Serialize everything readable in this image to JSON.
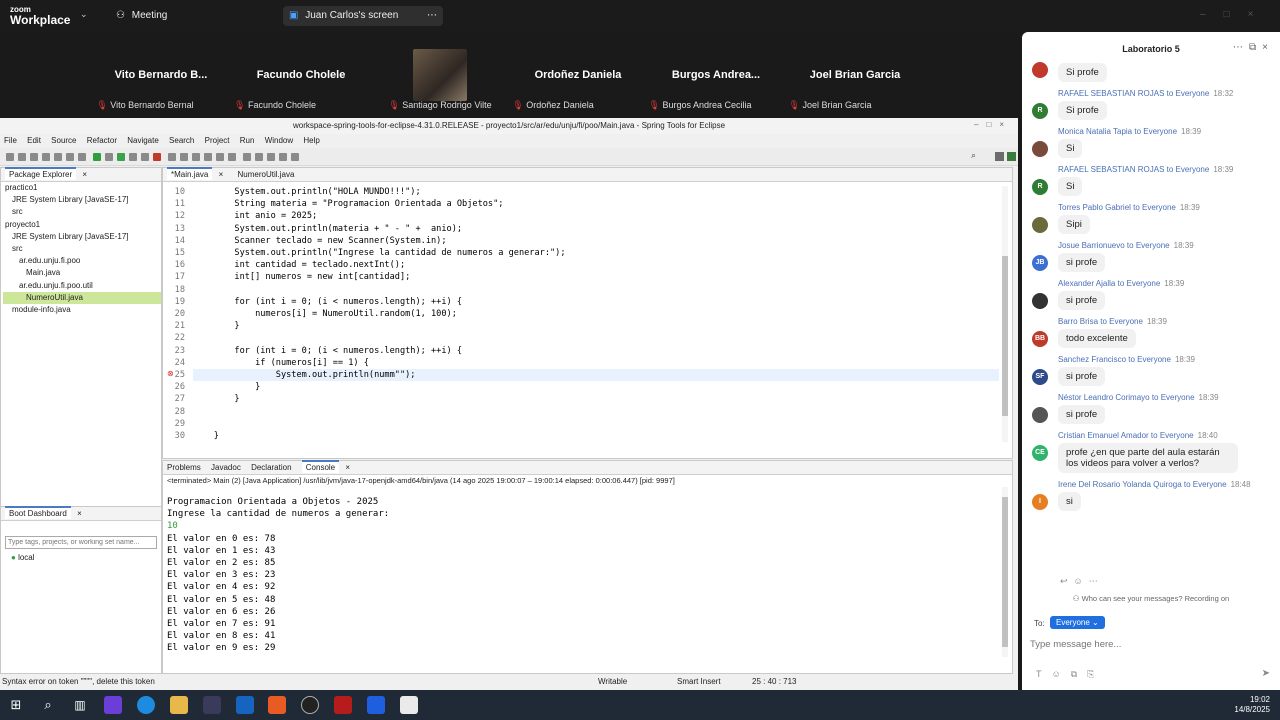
{
  "zoom": {
    "logo_top": "zoom",
    "logo_bottom": "Workplace",
    "tabs": [
      {
        "label": "Meeting"
      },
      {
        "label": "Juan Carlos's screen"
      }
    ]
  },
  "participants": [
    {
      "name": "Vito Bernardo B...",
      "full": "Vito Bernardo Bernal"
    },
    {
      "name": "Facundo Cholele",
      "full": "Facundo Cholele"
    },
    {
      "name": "",
      "full": "Santiago Rodrigo Vilte"
    },
    {
      "name": "Ordoñez Daniela",
      "full": "Ordoñez Daniela"
    },
    {
      "name": "Burgos Andrea...",
      "full": "Burgos Andrea Cecilia"
    },
    {
      "name": "Joel Brian Garcia",
      "full": "Joel Brian Garcia"
    }
  ],
  "eclipse": {
    "title": "workspace-spring-tools-for-eclipse-4.31.0.RELEASE - proyecto1/src/ar/edu/unju/fi/poo/Main.java - Spring Tools for Eclipse",
    "menu": [
      "File",
      "Edit",
      "Source",
      "Refactor",
      "Navigate",
      "Search",
      "Project",
      "Run",
      "Window",
      "Help"
    ],
    "explorer_tab": "Package Explorer",
    "tree": [
      {
        "label": "practico1",
        "indent": 0
      },
      {
        "label": "JRE System Library [JavaSE-17]",
        "indent": 1
      },
      {
        "label": "src",
        "indent": 1
      },
      {
        "label": "proyecto1",
        "indent": 0
      },
      {
        "label": "JRE System Library [JavaSE-17]",
        "indent": 1
      },
      {
        "label": "src",
        "indent": 1
      },
      {
        "label": "ar.edu.unju.fi.poo",
        "indent": 2
      },
      {
        "label": "Main.java",
        "indent": 3
      },
      {
        "label": "ar.edu.unju.fi.poo.util",
        "indent": 2
      },
      {
        "label": "NumeroUtil.java",
        "indent": 3,
        "selected": true
      },
      {
        "label": "module-info.java",
        "indent": 1
      }
    ],
    "editor_tabs": [
      "*Main.java",
      "NumeroUtil.java"
    ],
    "code_lines": [
      {
        "n": "10",
        "text": "        System.out.println(\"HOLA MUNDO!!!\");"
      },
      {
        "n": "11",
        "text": "        String materia = \"Programacion Orientada a Objetos\";"
      },
      {
        "n": "12",
        "text": "        int anio = 2025;"
      },
      {
        "n": "13",
        "text": "        System.out.println(materia + \" - \" +  anio);"
      },
      {
        "n": "14",
        "text": "        Scanner teclado = new Scanner(System.in);"
      },
      {
        "n": "15",
        "text": "        System.out.println(\"Ingrese la cantidad de numeros a generar:\");"
      },
      {
        "n": "16",
        "text": "        int cantidad = teclado.nextInt();"
      },
      {
        "n": "17",
        "text": "        int[] numeros = new int[cantidad];"
      },
      {
        "n": "18",
        "text": ""
      },
      {
        "n": "19",
        "text": "        for (int i = 0; (i < numeros.length); ++i) {"
      },
      {
        "n": "20",
        "text": "            numeros[i] = NumeroUtil.random(1, 100);"
      },
      {
        "n": "21",
        "text": "        }"
      },
      {
        "n": "22",
        "text": ""
      },
      {
        "n": "23",
        "text": "        for (int i = 0; (i < numeros.length); ++i) {"
      },
      {
        "n": "24",
        "text": "            if (numeros[i] == 1) {"
      },
      {
        "n": "25",
        "text": "                System.out.println(numm\"\");"
      },
      {
        "n": "26",
        "text": "            }"
      },
      {
        "n": "27",
        "text": "        }"
      },
      {
        "n": "28",
        "text": ""
      },
      {
        "n": "29",
        "text": ""
      },
      {
        "n": "30",
        "text": "    }"
      }
    ],
    "console_tabs": [
      "Problems",
      "Javadoc",
      "Declaration",
      "Console"
    ],
    "console_header": "<terminated> Main (2) [Java Application] /usr/lib/jvm/java-17-openjdk-amd64/bin/java (14 ago 2025 19:00:07 – 19:00:14 elapsed: 0:00:06.447) [pid: 9997]",
    "console_lines": [
      "Programacion Orientada a Objetos - 2025",
      "Ingrese la cantidad de numeros a generar:",
      "10",
      "El valor en 0 es: 78",
      "El valor en 1 es: 43",
      "El valor en 2 es: 85",
      "El valor en 3 es: 23",
      "El valor en 4 es: 92",
      "El valor en 5 es: 48",
      "El valor en 6 es: 26",
      "El valor en 7 es: 91",
      "El valor en 8 es: 41",
      "El valor en 9 es: 29"
    ],
    "boot_tab": "Boot Dashboard",
    "boot_placeholder": "Type tags, projects, or working set name...",
    "boot_item": "local",
    "status_msg": "Syntax error on token \"\"\"\", delete this token",
    "status_writable": "Writable",
    "status_insert": "Smart Insert",
    "status_pos": "25 : 40 : 713"
  },
  "chat": {
    "title": "Laboratorio 5",
    "messages": [
      {
        "from": "",
        "time": "",
        "text": "Si profe",
        "avatar": "",
        "color": "#c0392b"
      },
      {
        "from": "RAFAEL SEBASTIAN ROJAS to Everyone",
        "time": "18:32",
        "text": "Si profe",
        "avatar": "R",
        "color": "#2e7d32"
      },
      {
        "from": "Monica Natalia Tapia to Everyone",
        "time": "18:39",
        "text": "Si",
        "avatar": "",
        "color": "#7a4b3a"
      },
      {
        "from": "RAFAEL SEBASTIAN ROJAS to Everyone",
        "time": "18:39",
        "text": "Si",
        "avatar": "R",
        "color": "#2e7d32"
      },
      {
        "from": "Torres Pablo Gabriel to Everyone",
        "time": "18:39",
        "text": "Sipi",
        "avatar": "",
        "color": "#6a6a3a"
      },
      {
        "from": "Josue Barrionuevo to Everyone",
        "time": "18:39",
        "text": "si profe",
        "avatar": "JB",
        "color": "#3b6fd1"
      },
      {
        "from": "Alexander Ajalla to Everyone",
        "time": "18:39",
        "text": "si profe",
        "avatar": "",
        "color": "#333"
      },
      {
        "from": "Barro Brisa to Everyone",
        "time": "18:39",
        "text": "todo excelente",
        "avatar": "BB",
        "color": "#c0392b"
      },
      {
        "from": "Sanchez Francisco to Everyone",
        "time": "18:39",
        "text": "si profe",
        "avatar": "SF",
        "color": "#2e4a8a"
      },
      {
        "from": "Néstor Leandro Corimayo to Everyone",
        "time": "18:39",
        "text": "si profe",
        "avatar": "",
        "color": "#555"
      },
      {
        "from": "Cristian Emanuel Amador to Everyone",
        "time": "18:40",
        "text": "profe ¿en que parte del aula estarán los videos para volver a verlos?",
        "avatar": "CE",
        "color": "#2fb36b"
      },
      {
        "from": "Irene Del Rosario Yolanda Quiroga to Everyone",
        "time": "18:48",
        "text": "si",
        "avatar": "I",
        "color": "#e67e22"
      }
    ],
    "who_can_see": "Who can see your messages? Recording on",
    "to_label": "To:",
    "to_value": "Everyone",
    "input_placeholder": "Type message here..."
  },
  "taskbar": {
    "time": "19:02",
    "date": "14/8/2025"
  }
}
